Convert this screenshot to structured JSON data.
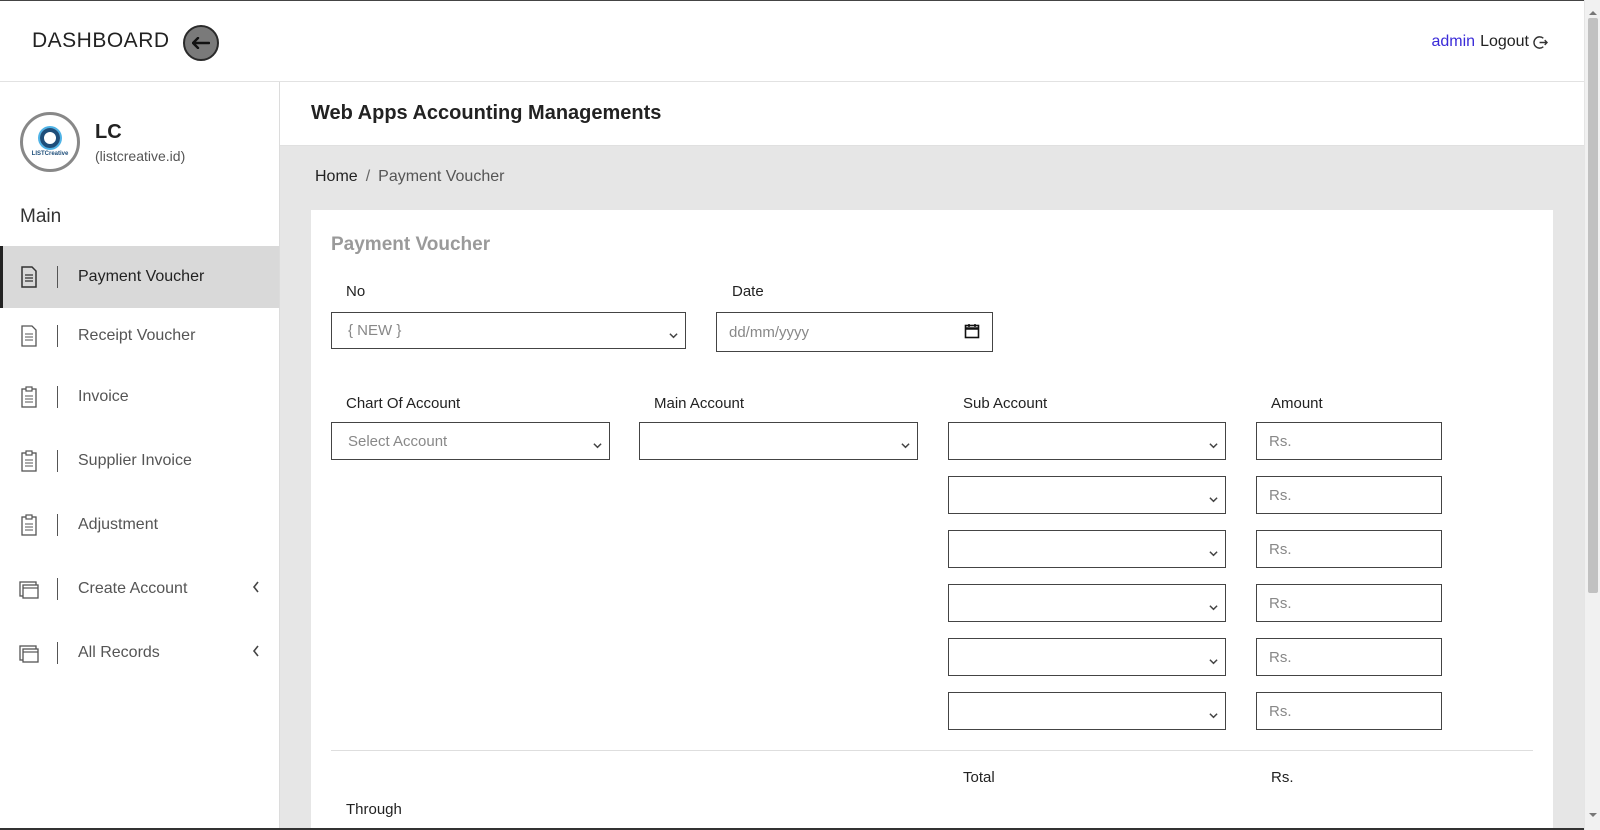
{
  "header": {
    "brand": "DASHBOARD",
    "user": "admin",
    "logout_label": "Logout"
  },
  "sidebar": {
    "profile_name": "LC",
    "profile_sub": "(listcreative.id)",
    "logo_text": "LISTCreative",
    "section_label": "Main",
    "items": [
      {
        "label": "Payment Voucher",
        "icon": "document-icon",
        "active": true
      },
      {
        "label": "Receipt Voucher",
        "icon": "document-icon",
        "active": false
      },
      {
        "label": "Invoice",
        "icon": "clipboard-icon",
        "active": false
      },
      {
        "label": "Supplier Invoice",
        "icon": "clipboard-icon",
        "active": false
      },
      {
        "label": "Adjustment",
        "icon": "clipboard-icon",
        "active": false
      },
      {
        "label": "Create Account",
        "icon": "window-icon",
        "has_submenu": true
      },
      {
        "label": "All Records",
        "icon": "window-icon",
        "has_submenu": true
      }
    ]
  },
  "page": {
    "title": "Web Apps Accounting Managements",
    "breadcrumb_home": "Home",
    "breadcrumb_separator": "/",
    "breadcrumb_current": "Payment Voucher"
  },
  "form": {
    "title": "Payment Voucher",
    "no_label": "No",
    "no_value": "{ NEW }",
    "date_label": "Date",
    "date_placeholder": "dd/mm/yyyy",
    "chart_label": "Chart Of Account",
    "chart_value": "Select Account",
    "main_label": "Main Account",
    "main_value": "",
    "sub_label": "Sub Account",
    "amount_label": "Amount",
    "amount_placeholder": "Rs.",
    "total_label": "Total",
    "total_value": "Rs.",
    "through_label": "Through"
  },
  "colors": {
    "accent_user": "#3a2bd8",
    "active_nav_bg": "#d9d9d9",
    "content_bg": "#e6e6e6"
  }
}
